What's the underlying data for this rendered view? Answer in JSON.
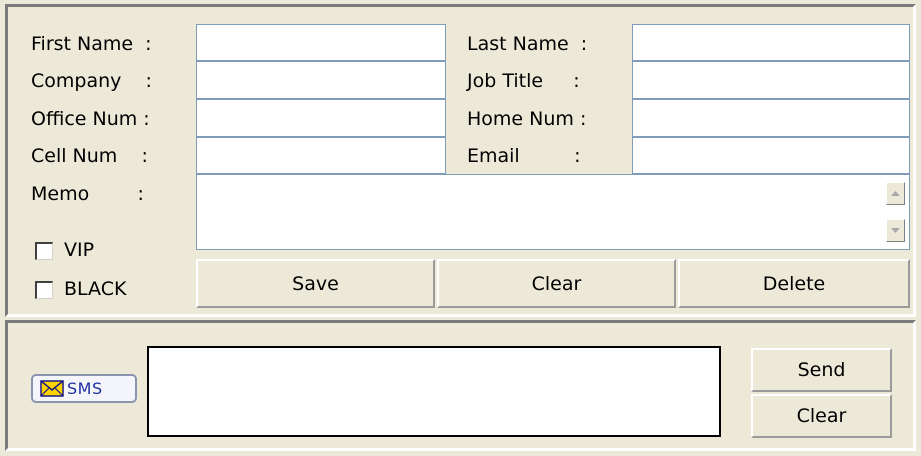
{
  "form": {
    "first_name": {
      "label": "First Name  :",
      "value": ""
    },
    "last_name": {
      "label": "Last Name  :",
      "value": ""
    },
    "company": {
      "label": "Company    :",
      "value": ""
    },
    "job_title": {
      "label": "Job Title     :",
      "value": ""
    },
    "office_num": {
      "label": "Office Num :",
      "value": ""
    },
    "home_num": {
      "label": "Home Num :",
      "value": ""
    },
    "cell_num": {
      "label": "Cell Num    :",
      "value": ""
    },
    "email": {
      "label": "Email         :",
      "value": ""
    },
    "memo": {
      "label": "Memo        :",
      "value": ""
    }
  },
  "checkboxes": {
    "vip": {
      "label": "VIP",
      "checked": false
    },
    "black": {
      "label": "BLACK",
      "checked": false
    }
  },
  "actions": {
    "save": "Save",
    "clear": "Clear",
    "delete": "Delete"
  },
  "sms": {
    "badge": "SMS",
    "icon": "envelope-icon",
    "message": "",
    "send": "Send",
    "clear": "Clear"
  },
  "colors": {
    "field_border": "#7f9db9",
    "envelope_fill": "#ffd400",
    "sms_text": "#2030a0"
  }
}
